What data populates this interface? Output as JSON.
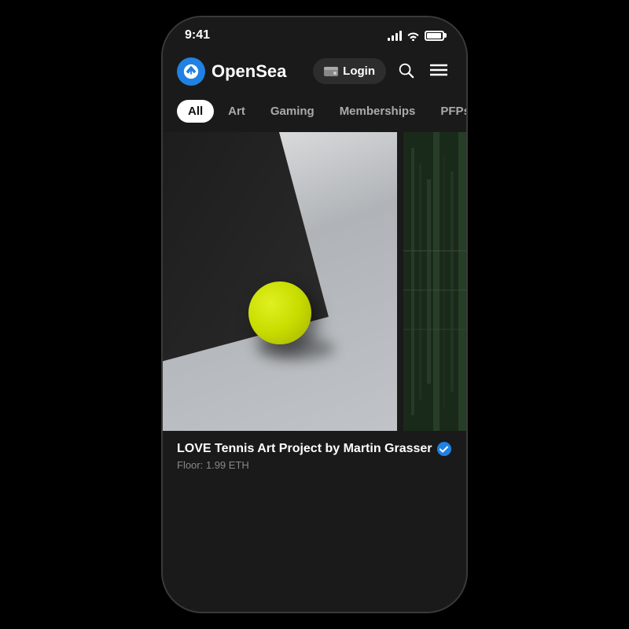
{
  "statusBar": {
    "time": "9:41",
    "batteryLabel": "battery"
  },
  "header": {
    "logoText": "OpenSea",
    "loginLabel": "Login",
    "searchLabel": "search",
    "menuLabel": "menu"
  },
  "tabs": [
    {
      "id": "all",
      "label": "All",
      "active": true
    },
    {
      "id": "art",
      "label": "Art",
      "active": false
    },
    {
      "id": "gaming",
      "label": "Gaming",
      "active": false
    },
    {
      "id": "memberships",
      "label": "Memberships",
      "active": false
    },
    {
      "id": "pfps",
      "label": "PFPs",
      "active": false
    }
  ],
  "nftCard": {
    "title": "LOVE Tennis Art Project by Martin Grasser",
    "floorLabel": "Floor:",
    "floorValue": "1.99 ETH",
    "verified": true
  },
  "colors": {
    "background": "#000000",
    "phoneBg": "#1a1a1a",
    "accent": "#2081e2",
    "activeTab": "#ffffff",
    "textPrimary": "#ffffff",
    "textSecondary": "#888888"
  }
}
